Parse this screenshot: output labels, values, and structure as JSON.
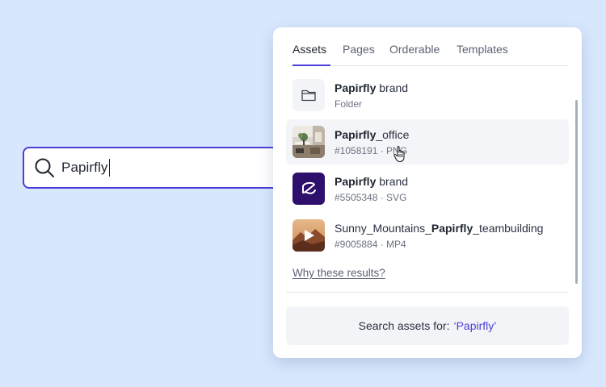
{
  "search": {
    "value": "Papirfly",
    "icon": "search-icon"
  },
  "tabs": [
    {
      "label": "Assets",
      "active": true
    },
    {
      "label": "Pages",
      "active": false
    },
    {
      "label": "Orderable",
      "active": false
    },
    {
      "label": "Templates",
      "active": false
    }
  ],
  "results": [
    {
      "title_bold": "Papirfly",
      "title_rest": " brand",
      "title_prefix": "",
      "meta": "Folder",
      "icon": "folder-icon"
    },
    {
      "title_bold": "Papirfly",
      "title_rest": "_office",
      "title_prefix": "",
      "meta": "#1058191 · PNG",
      "icon": "office-photo-thumbnail"
    },
    {
      "title_bold": "Papirfly",
      "title_rest": " brand",
      "title_prefix": "",
      "meta": "#5505348 · SVG",
      "icon": "papirfly-logo-icon"
    },
    {
      "title_bold": "Papirfly",
      "title_rest": "_teambuilding",
      "title_prefix": "Sunny_Mountains_",
      "meta": "#9005884 · MP4",
      "icon": "play-video-icon"
    }
  ],
  "why_link": "Why these results?",
  "search_assets": {
    "label": "Search assets for:",
    "query": "‘Papirfly’"
  },
  "colors": {
    "background": "#d8e7fd",
    "accent": "#4a3fd8",
    "logo_tile": "#2e0f6b"
  }
}
